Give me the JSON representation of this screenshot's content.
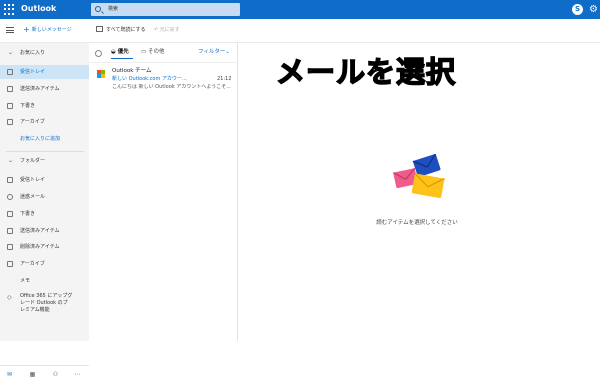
{
  "app": {
    "title": "Outlook"
  },
  "search": {
    "placeholder": "検索"
  },
  "command_bar": {
    "new_mail": "新しいメッセージ",
    "mark_all_read": "すべて既読にする",
    "undo": "元に戻す"
  },
  "sidebar": {
    "favorites_header": "お気に入り",
    "favorites": [
      {
        "label": "受信トレイ",
        "icon": "inbox-icon",
        "selected": true
      },
      {
        "label": "送信済みアイテム",
        "icon": "send-icon"
      },
      {
        "label": "下書き",
        "icon": "pencil-icon"
      },
      {
        "label": "アーカイブ",
        "icon": "archive-icon"
      }
    ],
    "add_favorite": "お気に入りに追加",
    "folders_header": "フォルダー",
    "folders": [
      {
        "label": "受信トレイ",
        "icon": "inbox-icon"
      },
      {
        "label": "迷惑メール",
        "icon": "block-icon"
      },
      {
        "label": "下書き",
        "icon": "pencil-icon"
      },
      {
        "label": "送信済みアイテム",
        "icon": "send-icon"
      },
      {
        "label": "削除済みアイテム",
        "icon": "trash-icon"
      },
      {
        "label": "アーカイブ",
        "icon": "archive-icon"
      },
      {
        "label": "メモ",
        "icon": ""
      }
    ],
    "upsell_lines": [
      "Office 365 にアップグ",
      "レード Outlook のプ",
      "レミアム機能"
    ],
    "bottom_icons": [
      "mail-icon",
      "calendar-icon",
      "people-icon",
      "more-icon"
    ]
  },
  "list": {
    "tab_focused": "優先",
    "tab_other": "その他",
    "filter": "フィルター",
    "messages": [
      {
        "sender": "Outlook チーム",
        "subject": "新しい Outlook.com アカウー...",
        "time": "21:12",
        "preview": "こんにちは 新しい Outlook アカウントへようこそ..."
      }
    ]
  },
  "reading_pane": {
    "overlay_text": "メールを選択",
    "empty_text": "読むアイテムを選択してください"
  },
  "colors": {
    "brand_blue": "#0f6cc9",
    "selected_nav": "#cce4f6",
    "overlay_fill": "#ffff1f",
    "envelope_blue": "#1f4fbf",
    "envelope_pink": "#ef5b8a",
    "envelope_yellow": "#ffc21a"
  }
}
